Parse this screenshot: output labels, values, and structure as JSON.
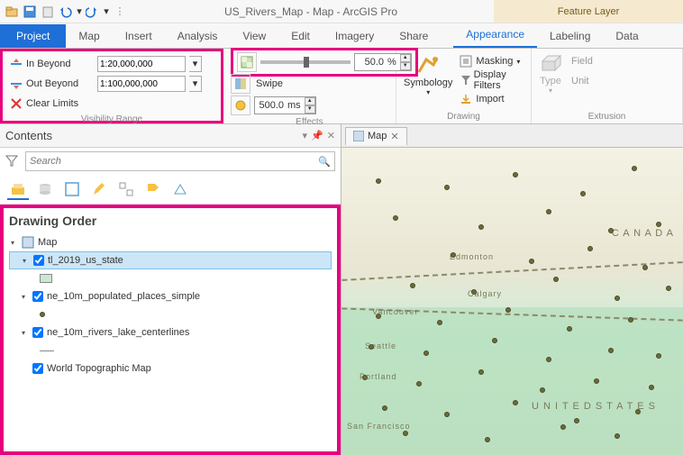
{
  "titlebar": {
    "title": "US_Rivers_Map - Map - ArcGIS Pro",
    "context_tab_group": "Feature Layer"
  },
  "tabs": {
    "file": "Project",
    "items": [
      "Map",
      "Insert",
      "Analysis",
      "View",
      "Edit",
      "Imagery",
      "Share"
    ],
    "context_items": [
      "Appearance",
      "Labeling",
      "Data"
    ],
    "active_context": "Appearance"
  },
  "ribbon": {
    "visibility_range": {
      "label": "Visibility Range",
      "in_beyond_label": "In Beyond",
      "in_beyond_value": "1:20,000,000",
      "out_beyond_label": "Out Beyond",
      "out_beyond_value": "1:100,000,000",
      "clear_limits_label": "Clear Limits"
    },
    "effects": {
      "label": "Effects",
      "transparency_value": "50.0",
      "transparency_unit": "%",
      "swipe_label": "Swipe",
      "flicker_value": "500.0",
      "flicker_unit": "ms"
    },
    "drawing": {
      "label": "Drawing",
      "symbology_label": "Symbology",
      "masking_label": "Masking",
      "display_filters_label": "Display Filters",
      "import_label": "Import"
    },
    "extrusion": {
      "label": "Extrusion",
      "type_label": "Type",
      "field_label": "Field",
      "unit_label": "Unit"
    }
  },
  "contents": {
    "title": "Contents",
    "search_placeholder": "Search",
    "drawing_order_label": "Drawing Order",
    "map_node": "Map",
    "layers": [
      {
        "name": "tl_2019_us_state",
        "checked": true,
        "selected": true,
        "swatch": "#c9e9d2"
      },
      {
        "name": "ne_10m_populated_places_simple",
        "checked": true,
        "selected": false,
        "point": true
      },
      {
        "name": "ne_10m_rivers_lake_centerlines",
        "checked": true,
        "selected": false,
        "line": true
      },
      {
        "name": "World Topographic Map",
        "checked": true,
        "selected": false,
        "basemap": true
      }
    ]
  },
  "map_view": {
    "tab_label": "Map",
    "labels": {
      "canada": "C A N A D A",
      "us": "U N I T E D    S T A T E S",
      "edmonton": "Edmonton",
      "calgary": "Calgary",
      "vancouver": "Vancouver",
      "seattle": "Seattle",
      "portland": "Portland",
      "sanfrancisco": "San Francisco"
    }
  }
}
